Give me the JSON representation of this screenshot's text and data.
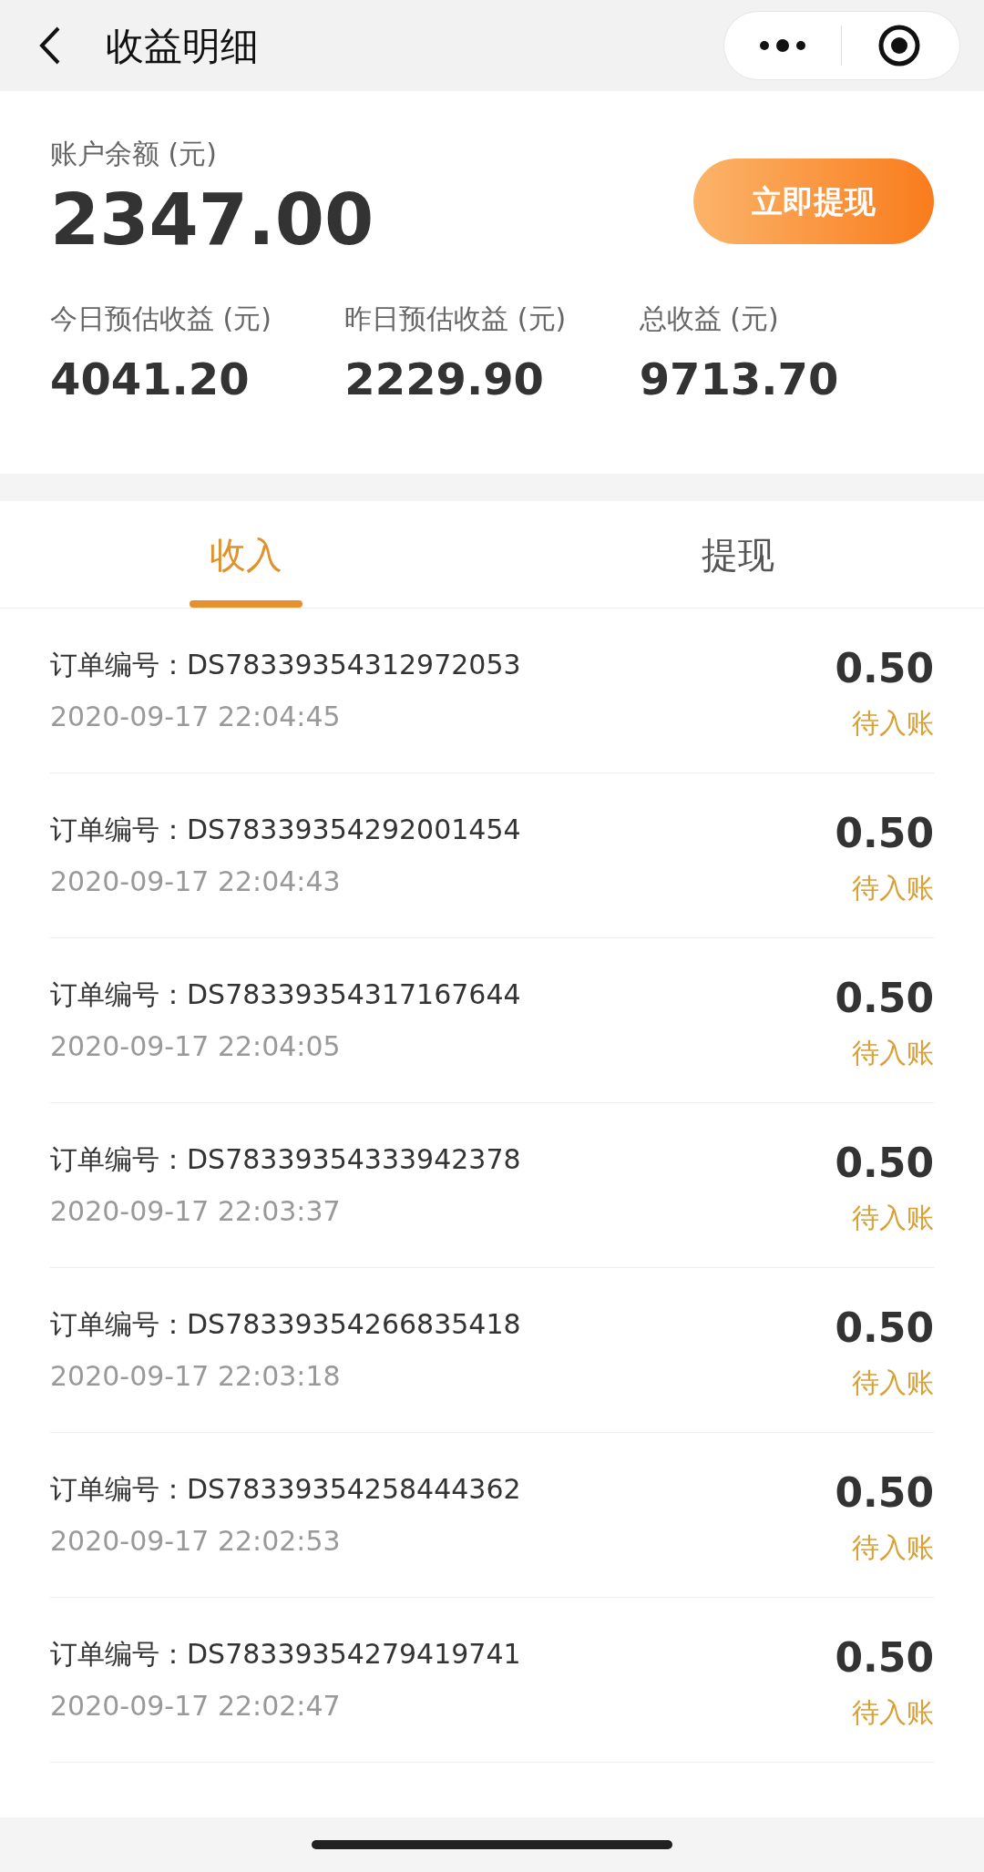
{
  "header": {
    "title": "收益明细"
  },
  "balance": {
    "label": "账户余额 (元)",
    "value": "2347.00",
    "button": "立即提现"
  },
  "stats": [
    {
      "label": "今日预估收益 (元)",
      "value": "4041.20"
    },
    {
      "label": "昨日预估收益 (元)",
      "value": "2229.90"
    },
    {
      "label": "总收益 (元)",
      "value": "9713.70"
    }
  ],
  "tabs": [
    {
      "label": "收入",
      "selected": true
    },
    {
      "label": "提现",
      "selected": false
    }
  ],
  "records": [
    {
      "order": "订单编号：DS78339354312972053",
      "time": "2020-09-17 22:04:45",
      "amount": "0.50",
      "status": "待入账"
    },
    {
      "order": "订单编号：DS78339354292001454",
      "time": "2020-09-17 22:04:43",
      "amount": "0.50",
      "status": "待入账"
    },
    {
      "order": "订单编号：DS78339354317167644",
      "time": "2020-09-17 22:04:05",
      "amount": "0.50",
      "status": "待入账"
    },
    {
      "order": "订单编号：DS78339354333942378",
      "time": "2020-09-17 22:03:37",
      "amount": "0.50",
      "status": "待入账"
    },
    {
      "order": "订单编号：DS78339354266835418",
      "time": "2020-09-17 22:03:18",
      "amount": "0.50",
      "status": "待入账"
    },
    {
      "order": "订单编号：DS78339354258444362",
      "time": "2020-09-17 22:02:53",
      "amount": "0.50",
      "status": "待入账"
    },
    {
      "order": "订单编号：DS78339354279419741",
      "time": "2020-09-17 22:02:47",
      "amount": "0.50",
      "status": "待入账"
    }
  ]
}
